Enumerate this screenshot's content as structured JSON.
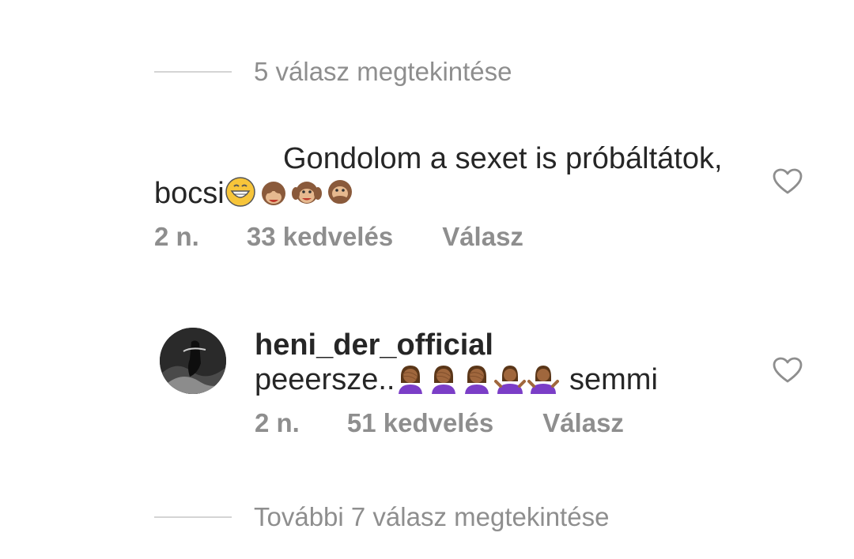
{
  "thread": {
    "view_replies_top": "5 válasz megtekintése",
    "view_replies_bottom": "További 7 válasz megtekintése"
  },
  "comments": [
    {
      "username": "",
      "text": "Gondolom a sexet is próbáltátok, bocsi",
      "emojis": [
        "grinning-face-emoji",
        "see-no-evil-monkey-emoji",
        "hear-no-evil-monkey-emoji",
        "speak-no-evil-monkey-emoji"
      ],
      "time": "2 n.",
      "likes": "33 kedvelés",
      "reply": "Válasz",
      "liked": false
    },
    {
      "username": "heni_der_official",
      "text_before": "peeersze..",
      "text_after": "semmi",
      "emojis": [
        "woman-facepalming-emoji",
        "woman-facepalming-emoji",
        "woman-facepalming-emoji",
        "woman-shrugging-emoji",
        "woman-shrugging-emoji"
      ],
      "time": "2 n.",
      "likes": "51 kedvelés",
      "reply": "Válasz",
      "liked": false
    }
  ],
  "colors": {
    "text": "#262626",
    "muted": "#8e8e8e",
    "divider": "#d4d4d4",
    "emoji_skin": "#a0673d",
    "emoji_purple": "#7b3ec7"
  }
}
